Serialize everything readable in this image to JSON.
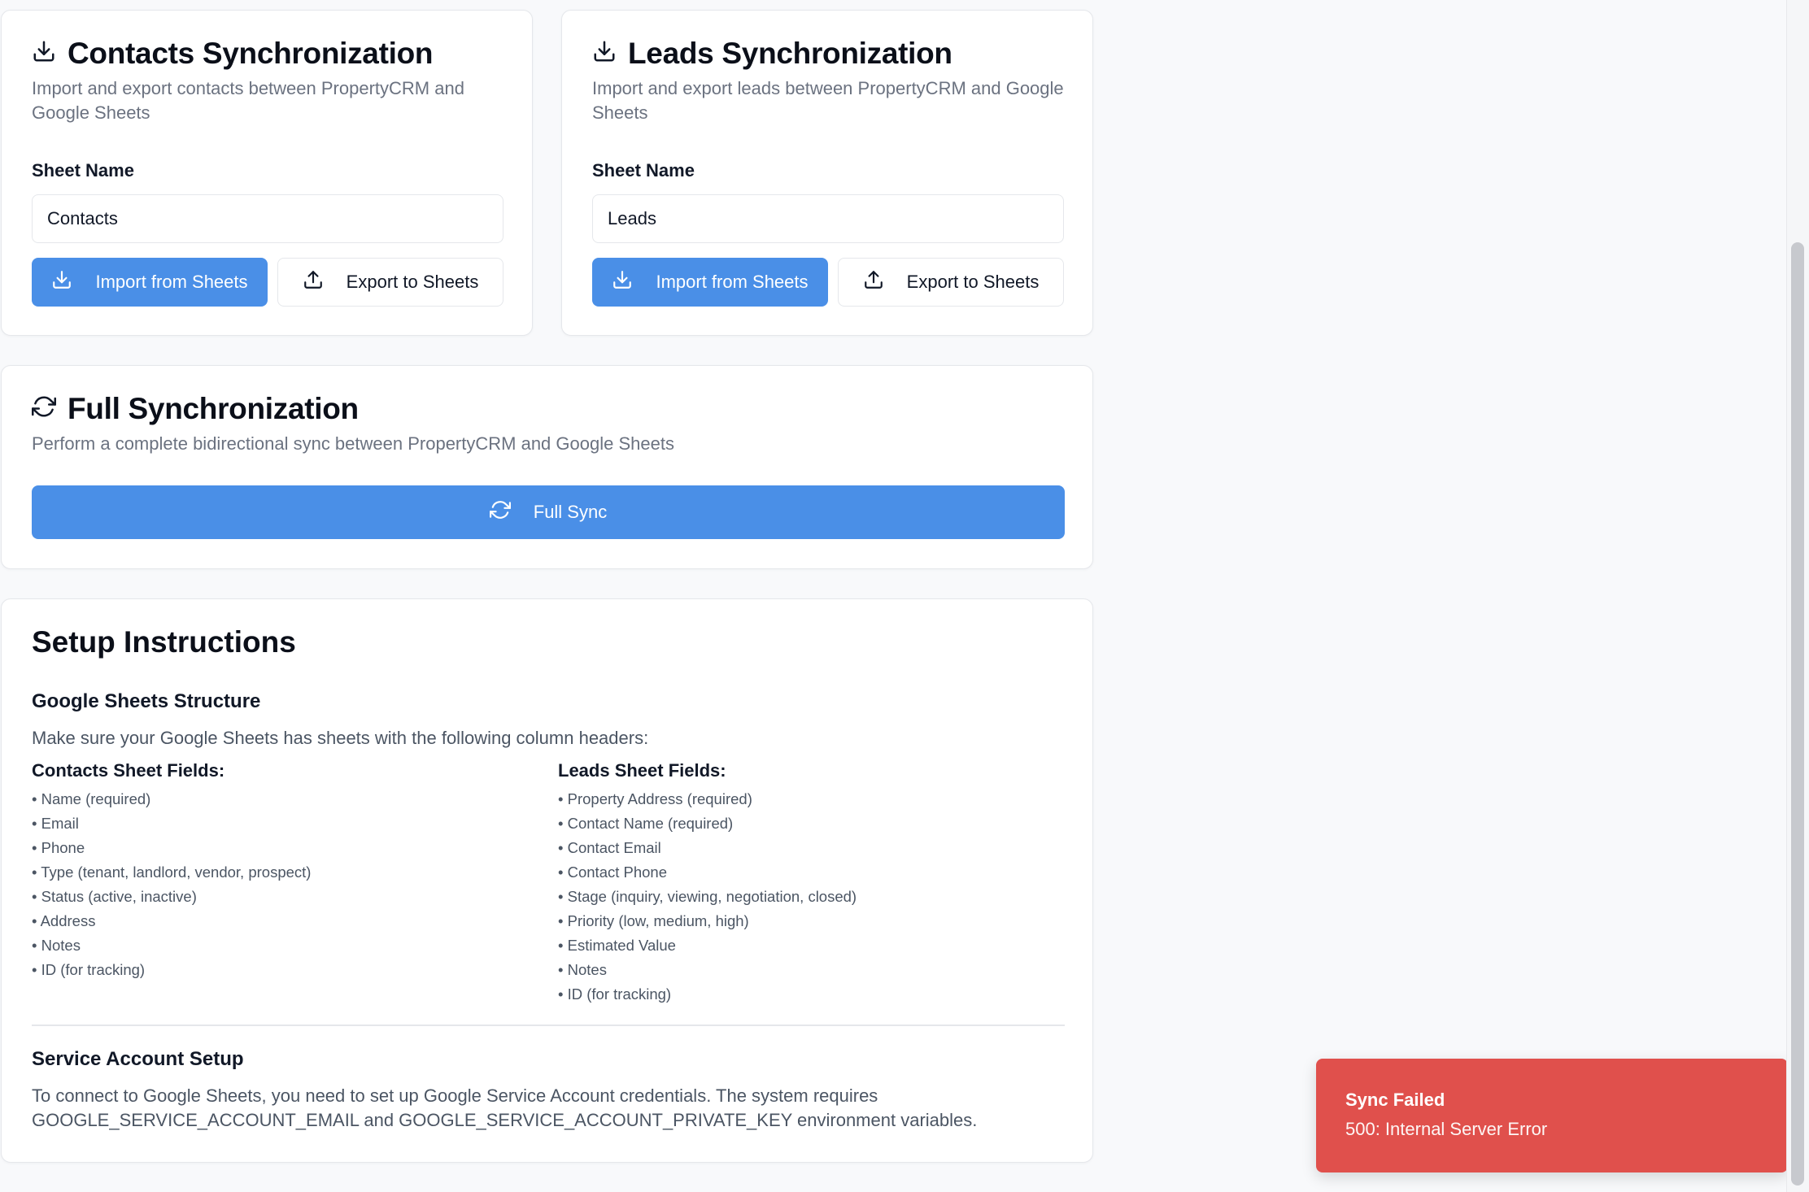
{
  "contacts": {
    "title": "Contacts Synchronization",
    "description": "Import and export contacts between PropertyCRM and Google Sheets",
    "sheet_label": "Sheet Name",
    "sheet_value": "Contacts",
    "import_label": "Import from Sheets",
    "export_label": "Export to Sheets"
  },
  "leads": {
    "title": "Leads Synchronization",
    "description": "Import and export leads between PropertyCRM and Google Sheets",
    "sheet_label": "Sheet Name",
    "sheet_value": "Leads",
    "import_label": "Import from Sheets",
    "export_label": "Export to Sheets"
  },
  "full_sync": {
    "title": "Full Synchronization",
    "description": "Perform a complete bidirectional sync between PropertyCRM and Google Sheets",
    "button_label": "Full Sync"
  },
  "setup": {
    "title": "Setup Instructions",
    "structure_title": "Google Sheets Structure",
    "structure_text": "Make sure your Google Sheets has sheets with the following column headers:",
    "contacts_fields_title": "Contacts Sheet Fields:",
    "contacts_fields": [
      "• Name (required)",
      "• Email",
      "• Phone",
      "• Type (tenant, landlord, vendor, prospect)",
      "• Status (active, inactive)",
      "• Address",
      "• Notes",
      "• ID (for tracking)"
    ],
    "leads_fields_title": "Leads Sheet Fields:",
    "leads_fields": [
      "• Property Address (required)",
      "• Contact Name (required)",
      "• Contact Email",
      "• Contact Phone",
      "• Stage (inquiry, viewing, negotiation, closed)",
      "• Priority (low, medium, high)",
      "• Estimated Value",
      "• Notes",
      "• ID (for tracking)"
    ],
    "service_title": "Service Account Setup",
    "service_text_line1": "To connect to Google Sheets, you need to set up Google Service Account credentials. The system requires",
    "service_text_line2": "GOOGLE_SERVICE_ACCOUNT_EMAIL and GOOGLE_SERVICE_ACCOUNT_PRIVATE_KEY environment variables."
  },
  "toast": {
    "title": "Sync Failed",
    "message": "500: Internal Server Error"
  },
  "icons": {
    "import": "download-icon",
    "export": "upload-icon",
    "sync": "refresh-icon"
  },
  "colors": {
    "primary": "#4a8fe7",
    "error": "#e0504c",
    "background": "#f8f9fb"
  }
}
